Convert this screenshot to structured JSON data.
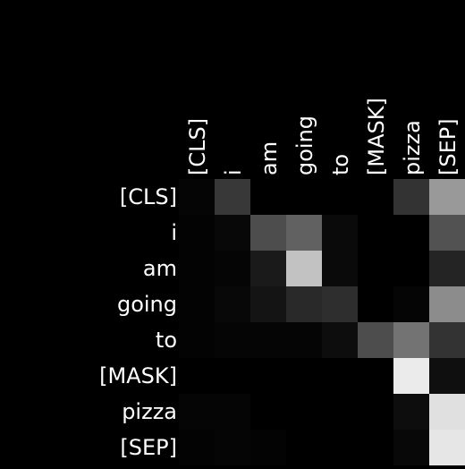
{
  "chart_data": {
    "type": "heatmap",
    "x_labels": [
      "[CLS]",
      "i",
      "am",
      "going",
      "to",
      "[MASK]",
      "pizza",
      "[SEP]"
    ],
    "y_labels": [
      "[CLS]",
      "i",
      "am",
      "going",
      "to",
      "[MASK]",
      "pizza",
      "[SEP]"
    ],
    "values": [
      [
        0.02,
        0.22,
        0.0,
        0.0,
        0.0,
        0.0,
        0.2,
        0.6
      ],
      [
        0.01,
        0.03,
        0.3,
        0.38,
        0.04,
        0.0,
        0.0,
        0.32
      ],
      [
        0.01,
        0.02,
        0.1,
        0.76,
        0.04,
        0.0,
        0.0,
        0.14
      ],
      [
        0.01,
        0.03,
        0.08,
        0.16,
        0.18,
        0.0,
        0.02,
        0.55
      ],
      [
        0.01,
        0.02,
        0.02,
        0.02,
        0.05,
        0.3,
        0.45,
        0.2
      ],
      [
        0.0,
        0.0,
        0.0,
        0.0,
        0.0,
        0.0,
        0.92,
        0.06
      ],
      [
        0.02,
        0.02,
        0.0,
        0.0,
        0.0,
        0.0,
        0.05,
        0.88
      ],
      [
        0.01,
        0.02,
        0.01,
        0.0,
        0.0,
        0.0,
        0.03,
        0.9
      ]
    ],
    "colormap": {
      "low": "#000000",
      "high": "#ffffff"
    },
    "label_color": "#ffffff",
    "background": "#000000",
    "grid": false,
    "legend": "none"
  }
}
